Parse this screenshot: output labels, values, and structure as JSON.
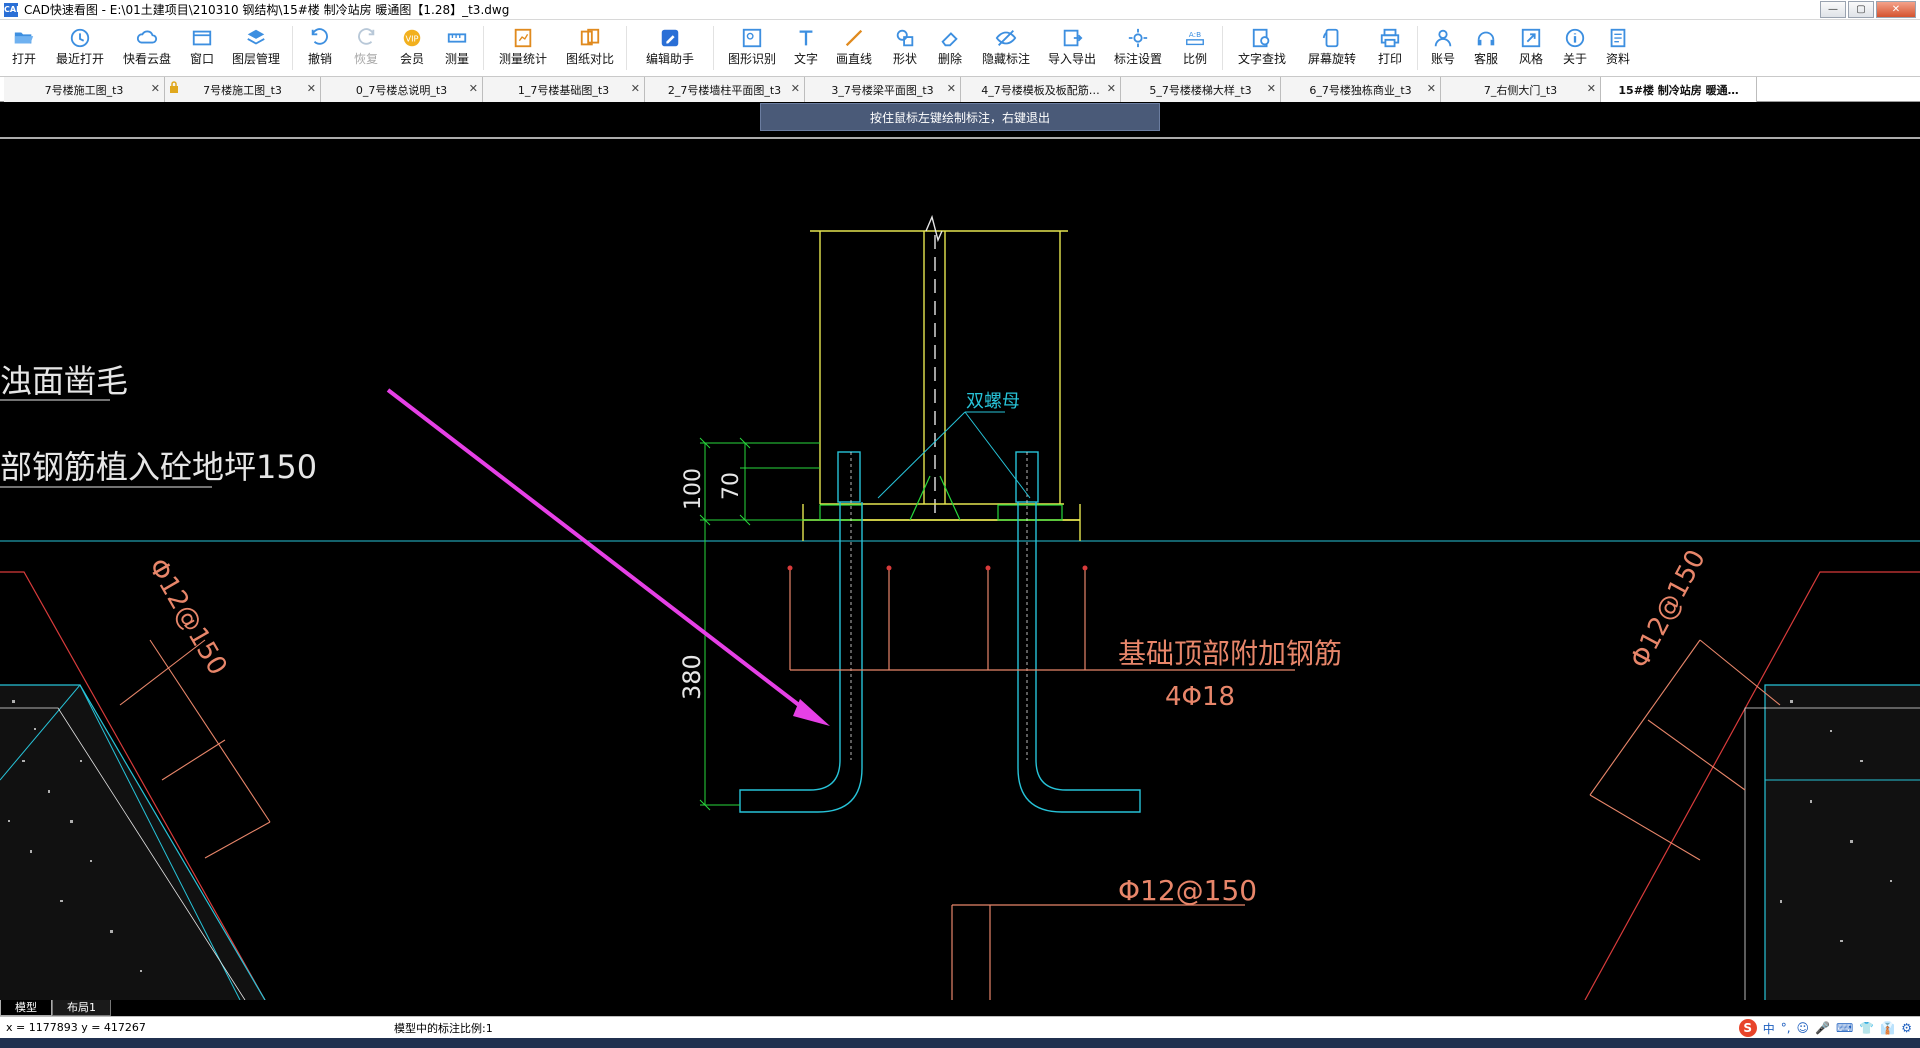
{
  "window": {
    "app_icon": "CAD",
    "title": "CAD快速看图 - E:\\01土建项目\\210310 钢结构\\15#楼 制冷站房 暖通图【1.28】_t3.dwg",
    "min": "—",
    "max": "▢",
    "close": "✕"
  },
  "toolbar": [
    {
      "label": "打开",
      "icon": "folder-open-icon"
    },
    {
      "label": "最近打开",
      "icon": "recent-icon"
    },
    {
      "label": "快看云盘",
      "icon": "cloud-icon"
    },
    {
      "label": "窗口",
      "icon": "window-icon"
    },
    {
      "label": "图层管理",
      "icon": "layers-icon"
    },
    {
      "label": "撤销",
      "icon": "undo-icon"
    },
    {
      "label": "恢复",
      "icon": "redo-icon",
      "disabled": true
    },
    {
      "label": "会员",
      "icon": "vip-icon"
    },
    {
      "label": "测量",
      "icon": "ruler-icon"
    },
    {
      "label": "测量统计",
      "icon": "measure-stats-icon"
    },
    {
      "label": "图纸对比",
      "icon": "compare-icon"
    },
    {
      "label": "编辑助手",
      "icon": "edit-assistant-icon"
    },
    {
      "label": "图形识别",
      "icon": "shape-recognize-icon"
    },
    {
      "label": "文字",
      "icon": "text-icon"
    },
    {
      "label": "画直线",
      "icon": "line-icon"
    },
    {
      "label": "形状",
      "icon": "shape-icon"
    },
    {
      "label": "删除",
      "icon": "eraser-icon"
    },
    {
      "label": "隐藏标注",
      "icon": "hide-eye-icon"
    },
    {
      "label": "导入导出",
      "icon": "import-export-icon"
    },
    {
      "label": "标注设置",
      "icon": "annotation-settings-icon"
    },
    {
      "label": "比例",
      "icon": "scale-icon"
    },
    {
      "label": "文字查找",
      "icon": "text-search-icon"
    },
    {
      "label": "屏幕旋转",
      "icon": "rotate-screen-icon"
    },
    {
      "label": "打印",
      "icon": "print-icon"
    },
    {
      "label": "账号",
      "icon": "account-icon"
    },
    {
      "label": "客服",
      "icon": "headset-icon"
    },
    {
      "label": "风格",
      "icon": "style-icon"
    },
    {
      "label": "关于",
      "icon": "info-icon"
    },
    {
      "label": "资料",
      "icon": "docs-icon"
    }
  ],
  "tabs": [
    {
      "label": "7号楼施工图_t3"
    },
    {
      "label": "7号楼施工图_t3",
      "locked": true
    },
    {
      "label": "0_7号楼总说明_t3"
    },
    {
      "label": "1_7号楼基础图_t3"
    },
    {
      "label": "2_7号楼墙柱平面图_t3"
    },
    {
      "label": "3_7号楼梁平面图_t3"
    },
    {
      "label": "4_7号楼模板及板配筋…"
    },
    {
      "label": "5_7号楼楼梯大样_t3"
    },
    {
      "label": "6_7号楼独栋商业_t3"
    },
    {
      "label": "7_右侧大门_t3"
    },
    {
      "label": "15#楼 制冷站房 暖通…",
      "active": true
    }
  ],
  "hint": "按住鼠标左键绘制标注，右键退出",
  "drawing": {
    "note_left_1": "浊面凿毛",
    "note_left_2": "部钢筋植入砼地坪150",
    "double_nut": "双螺母",
    "dim_100": "100",
    "dim_70": "70",
    "dim_380": "380",
    "rebar_label": "基础顶部附加钢筋",
    "rebar_spec": "4Φ18",
    "rebar_left": "Φ12@150",
    "rebar_right": "Φ12@150",
    "rebar_bottom": "Φ12@150"
  },
  "layout_tabs": [
    {
      "label": "模型",
      "active": true
    },
    {
      "label": "布局1"
    }
  ],
  "status": {
    "coords": "x = 1177893  y = 417267",
    "scale": "模型中的标注比例:1",
    "ime_logo": "S",
    "ime_items": [
      "中",
      "°,",
      "☺",
      "🎤",
      "⌨",
      "👕",
      "👔",
      "⚙"
    ]
  },
  "colors": {
    "cad_yellow": "#e6e651",
    "cad_cyan": "#27c3d8",
    "cad_green": "#27d83c",
    "cad_orange": "#e8866a",
    "cad_red": "#d83b3b",
    "cad_white": "#e6e6e6",
    "cad_magenta": "#e640e6"
  }
}
